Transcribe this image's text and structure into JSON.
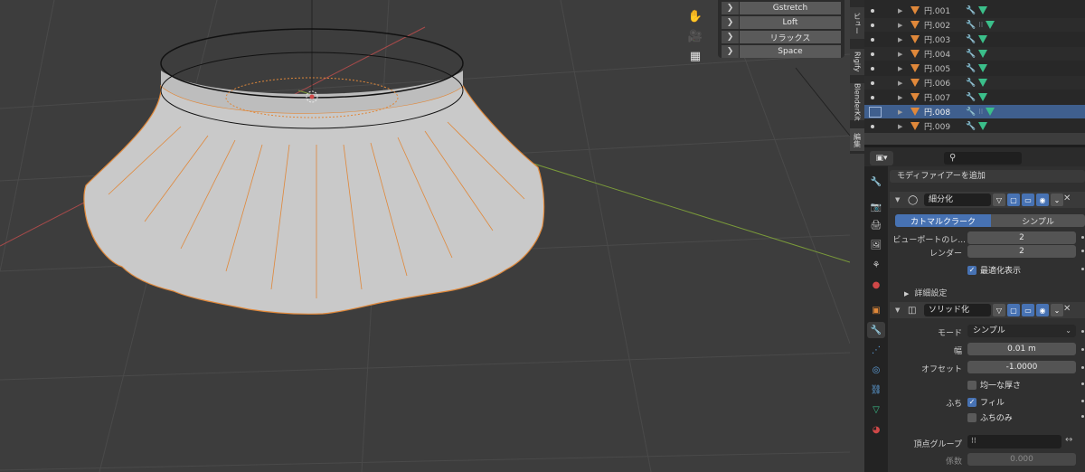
{
  "viewport": {
    "tools": [
      {
        "icon": "hand-pan-icon",
        "glyph": "✋"
      },
      {
        "icon": "camera-icon",
        "glyph": "🎥"
      },
      {
        "icon": "grid-icon",
        "glyph": "▦"
      }
    ],
    "operator_panel": {
      "buttons": [
        "Gstretch",
        "Loft",
        "リラックス",
        "Space"
      ]
    },
    "npanel_tabs": [
      "ビュー",
      "Rigify",
      "BlenderKit",
      "編集"
    ]
  },
  "outliner": {
    "rows": [
      {
        "name": "円.001",
        "selected": false
      },
      {
        "name": "円.002",
        "selected": false,
        "has_modifier_icon": true
      },
      {
        "name": "円.003",
        "selected": false
      },
      {
        "name": "円.004",
        "selected": false
      },
      {
        "name": "円.005",
        "selected": false
      },
      {
        "name": "円.006",
        "selected": false
      },
      {
        "name": "円.007",
        "selected": false
      },
      {
        "name": "円.008",
        "selected": true,
        "has_modifier_icon": true
      },
      {
        "name": "円.009",
        "selected": false
      }
    ]
  },
  "properties": {
    "editor_type_icon": "modifier-props-icon",
    "search_glyph": "⚲",
    "add_modifier_label": "モディファイアーを追加",
    "tabs": [
      {
        "icon": "tool-icon",
        "glyph": "🔧",
        "color": "#cfcfcf"
      },
      {
        "icon": "render-icon",
        "glyph": "📷",
        "color": "#cfcfcf"
      },
      {
        "icon": "output-icon",
        "glyph": "🖨",
        "color": "#cfcfcf"
      },
      {
        "icon": "view-layer-icon",
        "glyph": "🖼",
        "color": "#cfcfcf"
      },
      {
        "icon": "scene-icon",
        "glyph": "⚘",
        "color": "#cfcfcf"
      },
      {
        "icon": "world-icon",
        "glyph": "●",
        "color": "#d04848"
      },
      {
        "icon": "object-icon",
        "glyph": "▣",
        "color": "#e0883a"
      },
      {
        "icon": "modifier-icon",
        "glyph": "🔧",
        "color": "#5ea0dc"
      },
      {
        "icon": "particles-icon",
        "glyph": "⋰",
        "color": "#5ea0dc"
      },
      {
        "icon": "physics-icon",
        "glyph": "◎",
        "color": "#5ea0dc"
      },
      {
        "icon": "constraints-icon",
        "glyph": "⛓",
        "color": "#5ea0dc"
      },
      {
        "icon": "data-icon",
        "glyph": "▽",
        "color": "#3bbf8a"
      },
      {
        "icon": "material-icon",
        "glyph": "◕",
        "color": "#d04848"
      }
    ],
    "modifiers": [
      {
        "name": "細分化",
        "tabs": [
          "カトマルクラーク",
          "シンプル"
        ],
        "viewport_label": "ビューポートのレ...",
        "viewport_value": "2",
        "render_label": "レンダー",
        "render_value": "2",
        "optimal_display_label": "最適化表示",
        "advanced_label": "詳細設定"
      },
      {
        "name": "ソリッド化",
        "mode_label": "モード",
        "mode_value": "シンプル",
        "thickness_label": "幅",
        "thickness_value": "0.01 m",
        "offset_label": "オフセット",
        "offset_value": "-1.0000",
        "even_label": "均一な厚さ",
        "rim_label": "ふち",
        "fill_label": "フィル",
        "rim_only_label": "ふちのみ",
        "vgroup_label": "頂点グループ",
        "factor_label": "係数",
        "factor_value": "0.000"
      }
    ]
  },
  "colors": {
    "accent": "#4772b3",
    "selection_orange": "#e0883a",
    "x_axis": "#a84a4a",
    "y_axis": "#7a9a3a"
  }
}
